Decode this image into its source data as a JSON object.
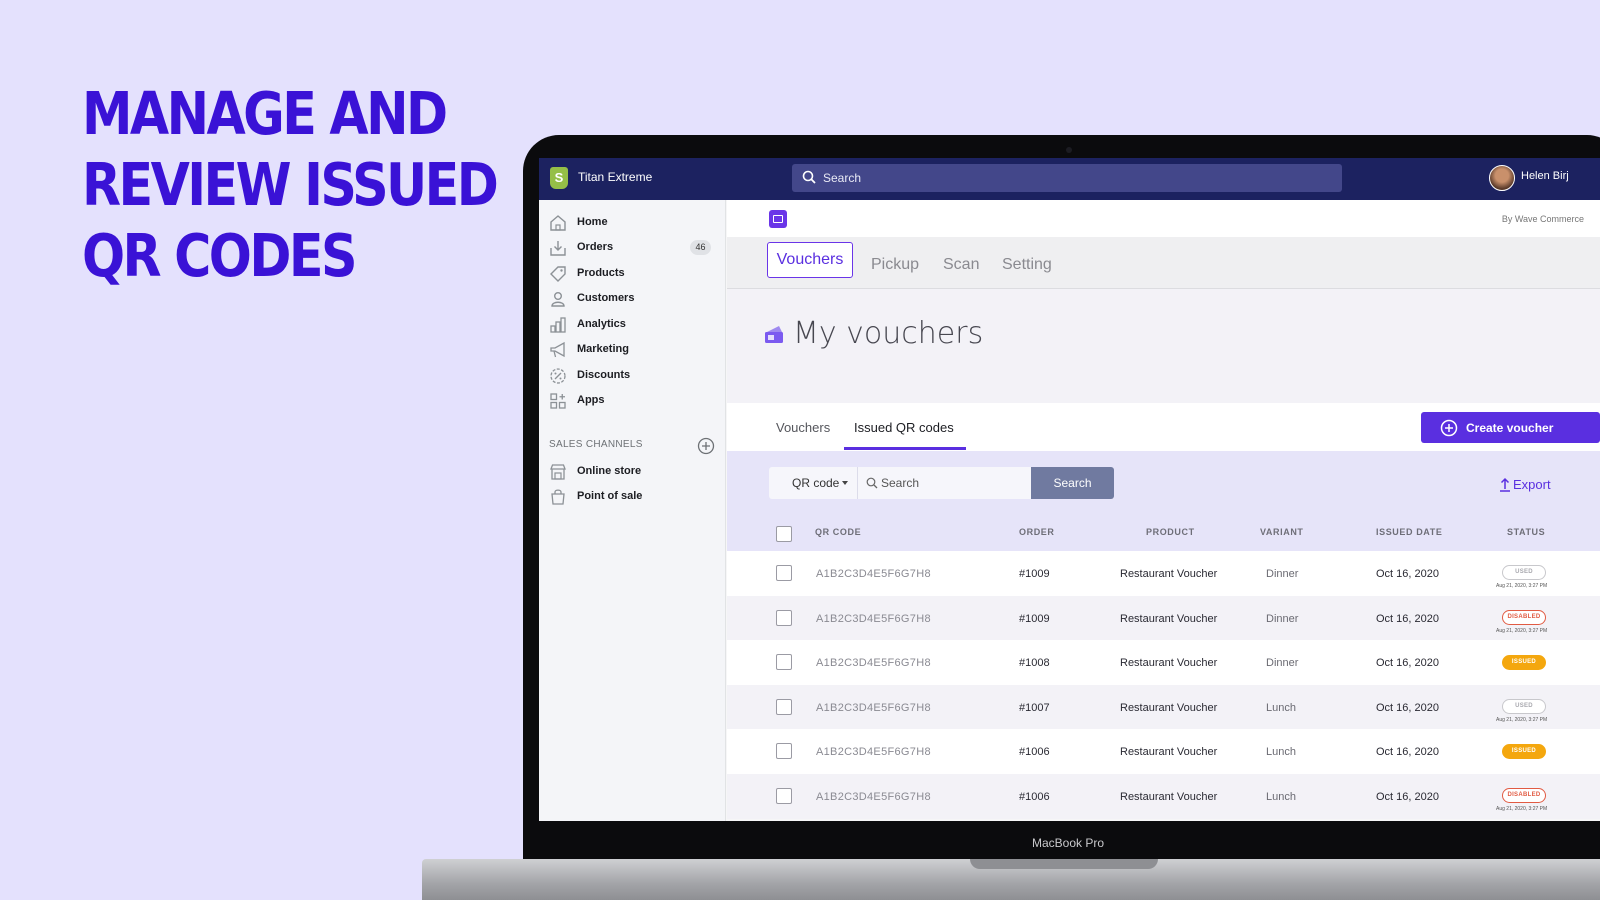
{
  "headline": [
    "MANAGE AND",
    "REVIEW ISSUED",
    "QR CODES"
  ],
  "device_label": "MacBook Pro",
  "topbar": {
    "store_name": "Titan Extreme",
    "search_placeholder": "Search",
    "user_name": "Helen Birj"
  },
  "sidebar": {
    "items": [
      {
        "label": "Home",
        "icon": "home-icon"
      },
      {
        "label": "Orders",
        "icon": "orders-icon",
        "badge": "46"
      },
      {
        "label": "Products",
        "icon": "tag-icon"
      },
      {
        "label": "Customers",
        "icon": "person-icon"
      },
      {
        "label": "Analytics",
        "icon": "bar-chart-icon"
      },
      {
        "label": "Marketing",
        "icon": "megaphone-icon"
      },
      {
        "label": "Discounts",
        "icon": "discount-icon"
      },
      {
        "label": "Apps",
        "icon": "apps-grid-icon"
      }
    ],
    "sales_channels_title": "SALES CHANNELS",
    "channels": [
      {
        "label": "Online store",
        "icon": "storefront-icon"
      },
      {
        "label": "Point of sale",
        "icon": "shopping-bag-icon"
      }
    ]
  },
  "app": {
    "by_label": "By Wave Commerce",
    "nav_tabs": [
      "Vouchers",
      "Pickup",
      "Scan",
      "Setting"
    ],
    "page_title": "My vouchers",
    "sub_tabs": [
      "Vouchers",
      "Issued QR codes"
    ],
    "create_button": "Create voucher",
    "filter": {
      "select_value": "QR code",
      "search_placeholder": "Search",
      "search_button": "Search",
      "export": "Export"
    },
    "columns": [
      "QR CODE",
      "ORDER",
      "PRODUCT",
      "VARIANT",
      "ISSUED DATE",
      "STATUS"
    ],
    "rows": [
      {
        "code": "A1B2C3D4E5F6G7H8",
        "order": "#1009",
        "product": "Restaurant Voucher",
        "variant": "Dinner",
        "date": "Oct 16, 2020",
        "status": "USED",
        "status_time": "Aug 21, 2020, 3:27 PM"
      },
      {
        "code": "A1B2C3D4E5F6G7H8",
        "order": "#1009",
        "product": "Restaurant Voucher",
        "variant": "Dinner",
        "date": "Oct 16, 2020",
        "status": "DISABLED",
        "status_time": "Aug 21, 2020, 3:27 PM"
      },
      {
        "code": "A1B2C3D4E5F6G7H8",
        "order": "#1008",
        "product": "Restaurant Voucher",
        "variant": "Dinner",
        "date": "Oct 16, 2020",
        "status": "ISSUED",
        "status_time": ""
      },
      {
        "code": "A1B2C3D4E5F6G7H8",
        "order": "#1007",
        "product": "Restaurant Voucher",
        "variant": "Lunch",
        "date": "Oct 16, 2020",
        "status": "USED",
        "status_time": "Aug 21, 2020, 3:27 PM"
      },
      {
        "code": "A1B2C3D4E5F6G7H8",
        "order": "#1006",
        "product": "Restaurant Voucher",
        "variant": "Lunch",
        "date": "Oct 16, 2020",
        "status": "ISSUED",
        "status_time": ""
      },
      {
        "code": "A1B2C3D4E5F6G7H8",
        "order": "#1006",
        "product": "Restaurant Voucher",
        "variant": "Lunch",
        "date": "Oct 16, 2020",
        "status": "DISABLED",
        "status_time": "Aug 21, 2020, 3:27 PM"
      }
    ]
  },
  "colors": {
    "background": "#e4e1fd",
    "headline": "#3a12d6",
    "accent": "#5a2fe0",
    "topbar": "#1c2260",
    "issued": "#f4a70e",
    "disabled": "#e15b43"
  }
}
